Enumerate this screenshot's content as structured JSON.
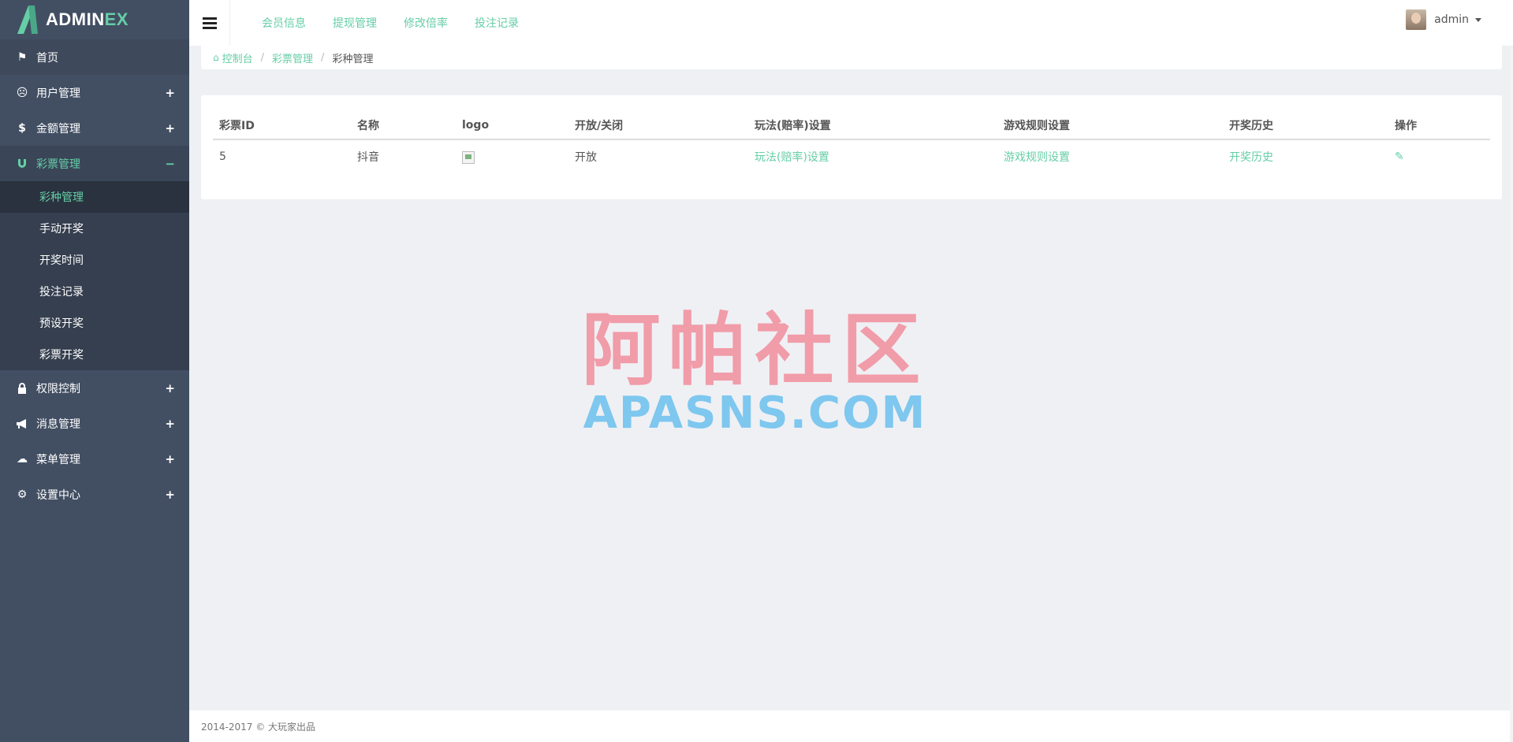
{
  "brand": {
    "text_main": "ADMIN",
    "text_accent": "EX"
  },
  "sidebar": {
    "items": [
      {
        "label": "首页",
        "icon": "flag-icon",
        "toggle": ""
      },
      {
        "label": "用户管理",
        "icon": "user-circle-icon",
        "toggle": "+"
      },
      {
        "label": "金额管理",
        "icon": "dollar-icon",
        "toggle": "+"
      },
      {
        "label": "彩票管理",
        "icon": "magnet-icon",
        "toggle": "−"
      },
      {
        "label": "权限控制",
        "icon": "lock-icon",
        "toggle": "+"
      },
      {
        "label": "消息管理",
        "icon": "bullhorn-icon",
        "toggle": "+"
      },
      {
        "label": "菜单管理",
        "icon": "cloud-icon",
        "toggle": "+"
      },
      {
        "label": "设置中心",
        "icon": "gear-icon",
        "toggle": "+"
      }
    ],
    "submenu": [
      "彩种管理",
      "手动开奖",
      "开奖时间",
      "投注记录",
      "预设开奖",
      "彩票开奖"
    ]
  },
  "header": {
    "nav": [
      "会员信息",
      "提现管理",
      "修改倍率",
      "投注记录"
    ],
    "user": "admin"
  },
  "breadcrumb": [
    "控制台",
    "彩票管理",
    "彩种管理"
  ],
  "table": {
    "headers": [
      "彩票ID",
      "名称",
      "logo",
      "开放/关闭",
      "玩法(赔率)设置",
      "游戏规则设置",
      "开奖历史",
      "操作"
    ],
    "rows": [
      {
        "id": "5",
        "name": "抖音",
        "status": "开放",
        "odds_link": "玩法(赔率)设置",
        "rules_link": "游戏规则设置",
        "history_link": "开奖历史"
      }
    ]
  },
  "watermark": {
    "cn": "阿帕社区",
    "en": "APASNS.COM"
  },
  "footer": {
    "text": "2014-2017 © 大玩家出品"
  },
  "colors": {
    "accent": "#65cea7",
    "sidebar": "#424f63",
    "background": "#eff0f4"
  }
}
